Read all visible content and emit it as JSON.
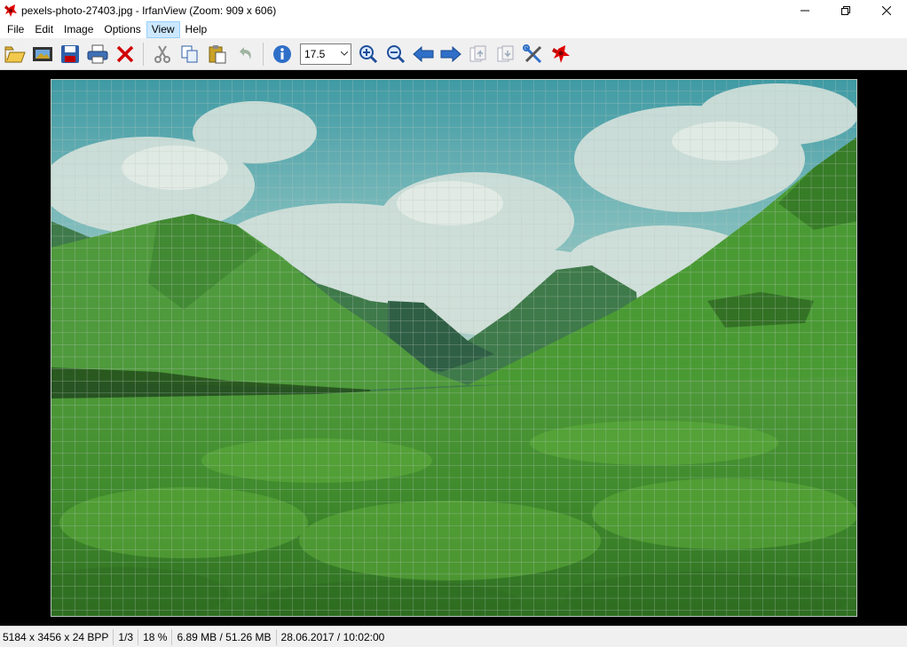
{
  "window": {
    "title": "pexels-photo-27403.jpg - IrfanView (Zoom: 909 x 606)"
  },
  "menu": {
    "items": [
      "File",
      "Edit",
      "Image",
      "Options",
      "View",
      "Help"
    ],
    "active": "View"
  },
  "toolbar": {
    "zoom_value": "17.5",
    "buttons": [
      "open-icon",
      "slideshow-icon",
      "save-icon",
      "print-icon",
      "delete-icon",
      "cut-icon",
      "copy-icon",
      "paste-icon",
      "undo-icon",
      "info-icon",
      "zoom-in-icon",
      "zoom-out-icon",
      "previous-icon",
      "next-icon",
      "first-page-icon",
      "last-page-icon",
      "settings-icon",
      "irfanview-icon"
    ]
  },
  "image": {
    "description_colors": {
      "sky": "#5fa8ab",
      "grass": "#4c9a37",
      "grid": "#a8b4a8"
    }
  },
  "status": {
    "dimensions": "5184 x 3456 x 24 BPP",
    "index": "1/3",
    "zoom": "18 %",
    "size": "6.89 MB / 51.26 MB",
    "datetime": "28.06.2017 / 10:02:00"
  },
  "colors": {
    "accent": "#cce8ff",
    "toolbar_bg": "#f0f0f0"
  }
}
